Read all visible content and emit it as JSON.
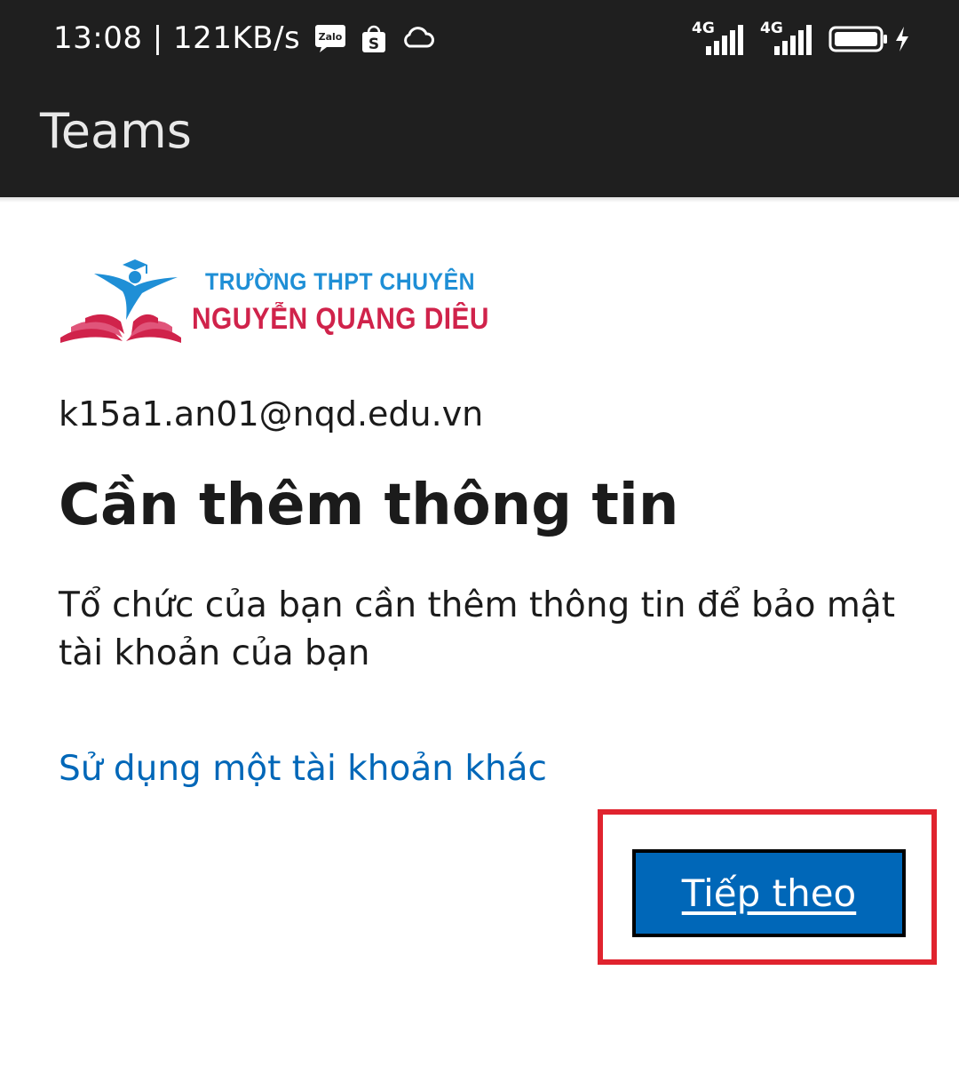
{
  "status_bar": {
    "time_speed": "13:08 | 121KB/s",
    "notification_icons": [
      "zalo-icon",
      "shopee-icon",
      "cloud-icon"
    ],
    "zalo_label": "Zalo",
    "shopee_label": "S",
    "sim1_network": "4G",
    "sim2_network": "4G",
    "battery_icon": "battery-full-icon",
    "charging_icon": "lightning-icon"
  },
  "app_bar": {
    "title": "Teams"
  },
  "logo": {
    "line1": "TRƯỜNG THPT CHUYÊN",
    "line2": "NGUYỄN QUANG DIÊU",
    "colors": {
      "blue": "#1f8fd6",
      "red": "#d0234b"
    }
  },
  "signin": {
    "email": "k15a1.an01@nqd.edu.vn",
    "heading": "Cần thêm thông tin",
    "description": "Tổ chức của bạn cần thêm thông tin để bảo mật tài khoản của bạn",
    "other_account_link": "Sử dụng một tài khoản khác",
    "next_button": "Tiếp theo"
  },
  "colors": {
    "link": "#0067b8",
    "button_bg": "#0067b8",
    "highlight": "#e0232e",
    "bar_bg": "#1f1f1f"
  }
}
